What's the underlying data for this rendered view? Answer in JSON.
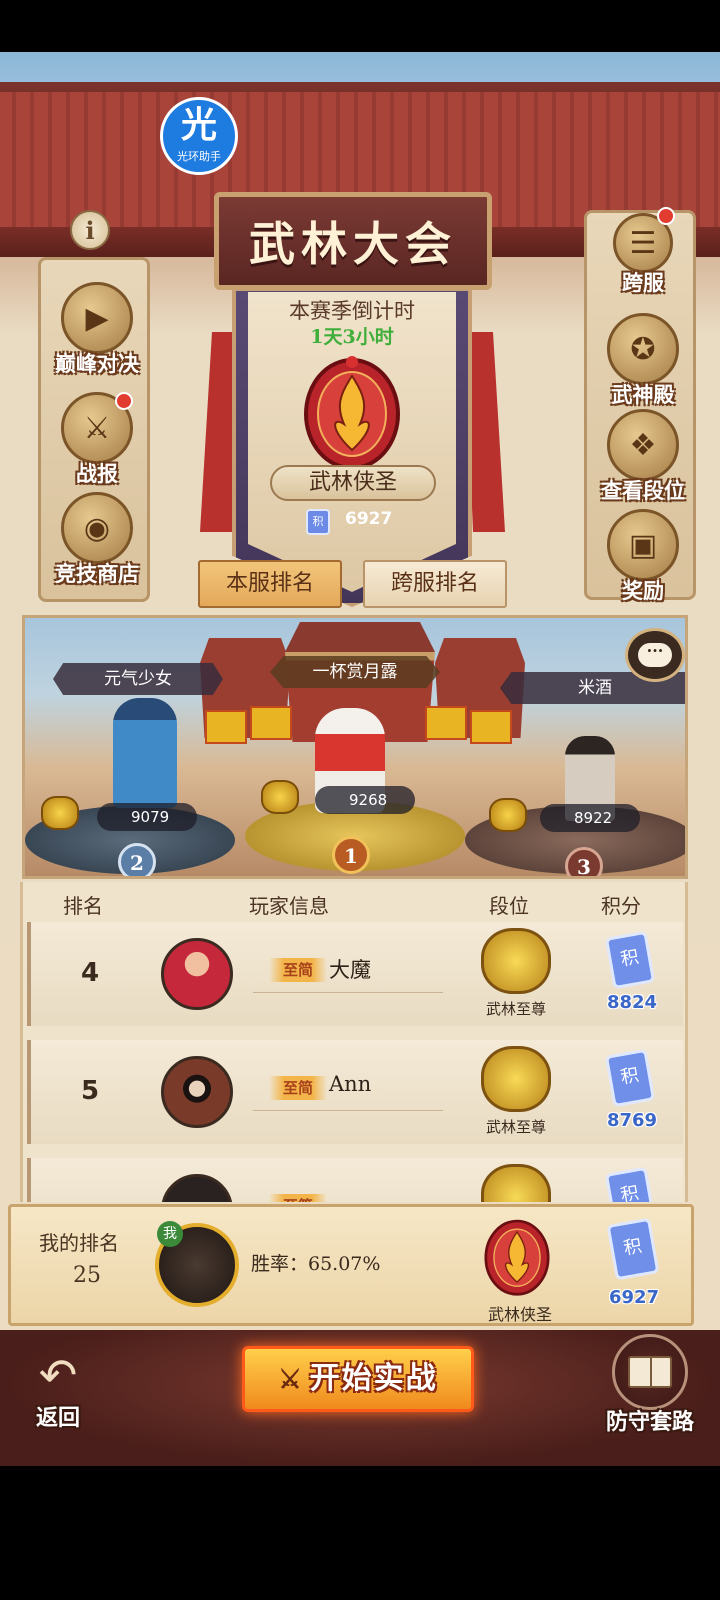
{
  "app": {
    "title": "武林大会",
    "helper_badge": {
      "glyph": "光",
      "label": "光环助手"
    },
    "info_glyph": "i"
  },
  "season": {
    "label": "本赛季倒计时",
    "countdown": "1天3小时",
    "rank_name": "武林侠圣",
    "score": "6927",
    "token_glyph": "积"
  },
  "left_menu": [
    {
      "label": "巅峰对决",
      "icon": "play-icon",
      "glyph": "▶",
      "badge": false
    },
    {
      "label": "战报",
      "icon": "crossed-swords-icon",
      "glyph": "⚔",
      "badge": true
    },
    {
      "label": "竞技商店",
      "icon": "shop-icon",
      "glyph": "◉",
      "badge": false
    }
  ],
  "right_menu": [
    {
      "label": "跨服",
      "icon": "list-icon",
      "glyph": "☰",
      "badge": true
    },
    {
      "label": "武神殿",
      "icon": "shrine-icon",
      "glyph": "✪",
      "badge": false
    },
    {
      "label": "查看段位",
      "icon": "dragon-emblem-icon",
      "glyph": "❖",
      "badge": false
    },
    {
      "label": "奖励",
      "icon": "chest-icon",
      "glyph": "▣",
      "badge": false
    }
  ],
  "tabs": {
    "local": "本服排名",
    "cross": "跨服排名",
    "active": "local"
  },
  "podium": [
    {
      "rank": "1",
      "name": "一杯赏月露",
      "score": "9268"
    },
    {
      "rank": "2",
      "name": "元气少女",
      "score": "9079"
    },
    {
      "rank": "3",
      "name": "米酒",
      "score": "8922"
    }
  ],
  "chat_glyph": "···",
  "list": {
    "headers": {
      "rank": "排名",
      "player": "玩家信息",
      "tier": "段位",
      "score": "积分"
    },
    "rows": [
      {
        "rank": "4",
        "tag": "至简",
        "name": "大魔",
        "tier": "武林至尊",
        "score": "8824",
        "avatar_color": "#c4283a"
      },
      {
        "rank": "5",
        "tag": "至简",
        "name": "Ann",
        "tier": "武林至尊",
        "score": "8769",
        "avatar_color": "#7a3a2a"
      },
      {
        "rank": "",
        "tag": "至简",
        "name": "",
        "tier": "",
        "score": "",
        "avatar_color": "#2a2220"
      }
    ]
  },
  "my_rank": {
    "label": "我的排名",
    "value": "25",
    "me_tag": "我",
    "winrate": "胜率：65.07%",
    "tier": "武林侠圣",
    "score": "6927"
  },
  "bottom": {
    "back": "返回",
    "start": "开始实战",
    "defense": "防守套路"
  },
  "colors": {
    "accent_gold": "#f2c57b",
    "countdown_green": "#3fae3a",
    "score_blue": "#3a66c8",
    "roof_red": "#a9443b",
    "badge_red": "#e23b2f"
  }
}
